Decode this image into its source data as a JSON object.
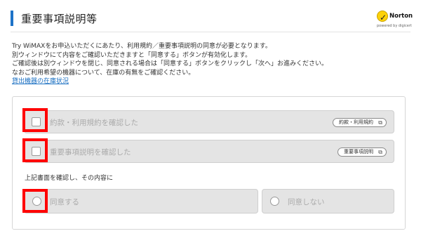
{
  "header": {
    "title": "重要事項説明等"
  },
  "norton": {
    "name": "Norton",
    "sub": "powered by digicert",
    "mark": "✓"
  },
  "intro": {
    "lines": [
      "Try WiMAXをお申込いただくにあたり、利用規約／重要事項説明の同意が必要となります。",
      "別ウィンドウにて内容をご確認いただきますと「同意する」ボタンが有効化します。",
      "ご確認後は別ウィンドウを閉じ、同意される場合は「同意する」ボタンをクリックし「次へ」お進みください。",
      "なおご利用希望の機器について、在庫の有無をご確認ください。"
    ],
    "stock_link": "貸出機器の在庫状況"
  },
  "checks": [
    {
      "label": "約款・利用規約を確認した",
      "doc_button": "約款・利用規約"
    },
    {
      "label": "重要事項説明を確認した",
      "doc_button": "重要事項説明"
    }
  ],
  "confirm_label": "上記書面を確認し、その内容に",
  "options": {
    "agree": "同意する",
    "disagree": "同意しない"
  },
  "icons": {
    "external": "⧉"
  },
  "colors": {
    "accent": "#1e73c8",
    "highlight": "#ff0000",
    "link": "#1a6fc2"
  }
}
